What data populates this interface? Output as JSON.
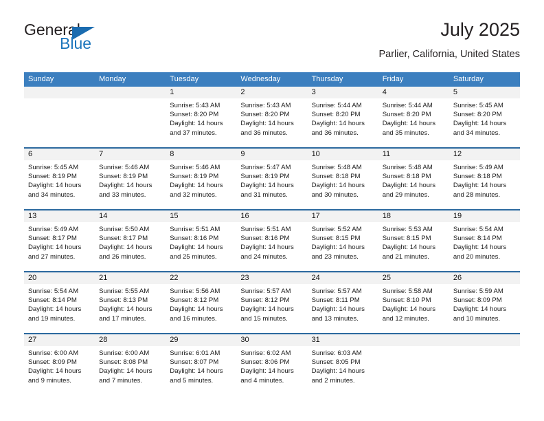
{
  "logo": {
    "word_one": "General",
    "word_two": "Blue",
    "triangle_color": "#1b6cb0",
    "blue_color": "#1b75bc"
  },
  "header": {
    "title": "July 2025",
    "subtitle": "Parlier, California, United States"
  },
  "theme": {
    "header_blue": "#3c7fbf",
    "separator_blue": "#2c699f",
    "date_band_gray": "#f2f2f2"
  },
  "weekdays": [
    "Sunday",
    "Monday",
    "Tuesday",
    "Wednesday",
    "Thursday",
    "Friday",
    "Saturday"
  ],
  "weeks": [
    [
      {
        "day": "",
        "sunrise": "",
        "sunset": "",
        "daylight_line1": "",
        "daylight_line2": ""
      },
      {
        "day": "",
        "sunrise": "",
        "sunset": "",
        "daylight_line1": "",
        "daylight_line2": ""
      },
      {
        "day": "1",
        "sunrise": "Sunrise: 5:43 AM",
        "sunset": "Sunset: 8:20 PM",
        "daylight_line1": "Daylight: 14 hours",
        "daylight_line2": "and 37 minutes."
      },
      {
        "day": "2",
        "sunrise": "Sunrise: 5:43 AM",
        "sunset": "Sunset: 8:20 PM",
        "daylight_line1": "Daylight: 14 hours",
        "daylight_line2": "and 36 minutes."
      },
      {
        "day": "3",
        "sunrise": "Sunrise: 5:44 AM",
        "sunset": "Sunset: 8:20 PM",
        "daylight_line1": "Daylight: 14 hours",
        "daylight_line2": "and 36 minutes."
      },
      {
        "day": "4",
        "sunrise": "Sunrise: 5:44 AM",
        "sunset": "Sunset: 8:20 PM",
        "daylight_line1": "Daylight: 14 hours",
        "daylight_line2": "and 35 minutes."
      },
      {
        "day": "5",
        "sunrise": "Sunrise: 5:45 AM",
        "sunset": "Sunset: 8:20 PM",
        "daylight_line1": "Daylight: 14 hours",
        "daylight_line2": "and 34 minutes."
      }
    ],
    [
      {
        "day": "6",
        "sunrise": "Sunrise: 5:45 AM",
        "sunset": "Sunset: 8:19 PM",
        "daylight_line1": "Daylight: 14 hours",
        "daylight_line2": "and 34 minutes."
      },
      {
        "day": "7",
        "sunrise": "Sunrise: 5:46 AM",
        "sunset": "Sunset: 8:19 PM",
        "daylight_line1": "Daylight: 14 hours",
        "daylight_line2": "and 33 minutes."
      },
      {
        "day": "8",
        "sunrise": "Sunrise: 5:46 AM",
        "sunset": "Sunset: 8:19 PM",
        "daylight_line1": "Daylight: 14 hours",
        "daylight_line2": "and 32 minutes."
      },
      {
        "day": "9",
        "sunrise": "Sunrise: 5:47 AM",
        "sunset": "Sunset: 8:19 PM",
        "daylight_line1": "Daylight: 14 hours",
        "daylight_line2": "and 31 minutes."
      },
      {
        "day": "10",
        "sunrise": "Sunrise: 5:48 AM",
        "sunset": "Sunset: 8:18 PM",
        "daylight_line1": "Daylight: 14 hours",
        "daylight_line2": "and 30 minutes."
      },
      {
        "day": "11",
        "sunrise": "Sunrise: 5:48 AM",
        "sunset": "Sunset: 8:18 PM",
        "daylight_line1": "Daylight: 14 hours",
        "daylight_line2": "and 29 minutes."
      },
      {
        "day": "12",
        "sunrise": "Sunrise: 5:49 AM",
        "sunset": "Sunset: 8:18 PM",
        "daylight_line1": "Daylight: 14 hours",
        "daylight_line2": "and 28 minutes."
      }
    ],
    [
      {
        "day": "13",
        "sunrise": "Sunrise: 5:49 AM",
        "sunset": "Sunset: 8:17 PM",
        "daylight_line1": "Daylight: 14 hours",
        "daylight_line2": "and 27 minutes."
      },
      {
        "day": "14",
        "sunrise": "Sunrise: 5:50 AM",
        "sunset": "Sunset: 8:17 PM",
        "daylight_line1": "Daylight: 14 hours",
        "daylight_line2": "and 26 minutes."
      },
      {
        "day": "15",
        "sunrise": "Sunrise: 5:51 AM",
        "sunset": "Sunset: 8:16 PM",
        "daylight_line1": "Daylight: 14 hours",
        "daylight_line2": "and 25 minutes."
      },
      {
        "day": "16",
        "sunrise": "Sunrise: 5:51 AM",
        "sunset": "Sunset: 8:16 PM",
        "daylight_line1": "Daylight: 14 hours",
        "daylight_line2": "and 24 minutes."
      },
      {
        "day": "17",
        "sunrise": "Sunrise: 5:52 AM",
        "sunset": "Sunset: 8:15 PM",
        "daylight_line1": "Daylight: 14 hours",
        "daylight_line2": "and 23 minutes."
      },
      {
        "day": "18",
        "sunrise": "Sunrise: 5:53 AM",
        "sunset": "Sunset: 8:15 PM",
        "daylight_line1": "Daylight: 14 hours",
        "daylight_line2": "and 21 minutes."
      },
      {
        "day": "19",
        "sunrise": "Sunrise: 5:54 AM",
        "sunset": "Sunset: 8:14 PM",
        "daylight_line1": "Daylight: 14 hours",
        "daylight_line2": "and 20 minutes."
      }
    ],
    [
      {
        "day": "20",
        "sunrise": "Sunrise: 5:54 AM",
        "sunset": "Sunset: 8:14 PM",
        "daylight_line1": "Daylight: 14 hours",
        "daylight_line2": "and 19 minutes."
      },
      {
        "day": "21",
        "sunrise": "Sunrise: 5:55 AM",
        "sunset": "Sunset: 8:13 PM",
        "daylight_line1": "Daylight: 14 hours",
        "daylight_line2": "and 17 minutes."
      },
      {
        "day": "22",
        "sunrise": "Sunrise: 5:56 AM",
        "sunset": "Sunset: 8:12 PM",
        "daylight_line1": "Daylight: 14 hours",
        "daylight_line2": "and 16 minutes."
      },
      {
        "day": "23",
        "sunrise": "Sunrise: 5:57 AM",
        "sunset": "Sunset: 8:12 PM",
        "daylight_line1": "Daylight: 14 hours",
        "daylight_line2": "and 15 minutes."
      },
      {
        "day": "24",
        "sunrise": "Sunrise: 5:57 AM",
        "sunset": "Sunset: 8:11 PM",
        "daylight_line1": "Daylight: 14 hours",
        "daylight_line2": "and 13 minutes."
      },
      {
        "day": "25",
        "sunrise": "Sunrise: 5:58 AM",
        "sunset": "Sunset: 8:10 PM",
        "daylight_line1": "Daylight: 14 hours",
        "daylight_line2": "and 12 minutes."
      },
      {
        "day": "26",
        "sunrise": "Sunrise: 5:59 AM",
        "sunset": "Sunset: 8:09 PM",
        "daylight_line1": "Daylight: 14 hours",
        "daylight_line2": "and 10 minutes."
      }
    ],
    [
      {
        "day": "27",
        "sunrise": "Sunrise: 6:00 AM",
        "sunset": "Sunset: 8:09 PM",
        "daylight_line1": "Daylight: 14 hours",
        "daylight_line2": "and 9 minutes."
      },
      {
        "day": "28",
        "sunrise": "Sunrise: 6:00 AM",
        "sunset": "Sunset: 8:08 PM",
        "daylight_line1": "Daylight: 14 hours",
        "daylight_line2": "and 7 minutes."
      },
      {
        "day": "29",
        "sunrise": "Sunrise: 6:01 AM",
        "sunset": "Sunset: 8:07 PM",
        "daylight_line1": "Daylight: 14 hours",
        "daylight_line2": "and 5 minutes."
      },
      {
        "day": "30",
        "sunrise": "Sunrise: 6:02 AM",
        "sunset": "Sunset: 8:06 PM",
        "daylight_line1": "Daylight: 14 hours",
        "daylight_line2": "and 4 minutes."
      },
      {
        "day": "31",
        "sunrise": "Sunrise: 6:03 AM",
        "sunset": "Sunset: 8:05 PM",
        "daylight_line1": "Daylight: 14 hours",
        "daylight_line2": "and 2 minutes."
      },
      {
        "day": "",
        "sunrise": "",
        "sunset": "",
        "daylight_line1": "",
        "daylight_line2": ""
      },
      {
        "day": "",
        "sunrise": "",
        "sunset": "",
        "daylight_line1": "",
        "daylight_line2": ""
      }
    ]
  ]
}
